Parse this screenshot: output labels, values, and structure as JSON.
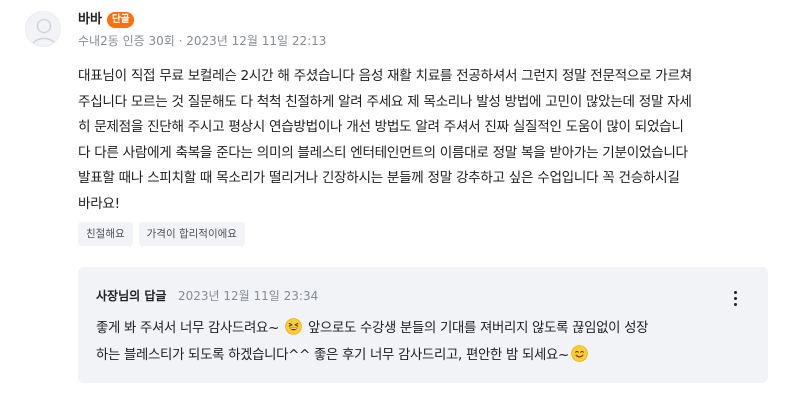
{
  "review": {
    "nickname": "바바",
    "badge": "단골",
    "meta": "수내2동 인증 30회 · 2023년 12월 11일 22:13",
    "body_lines": [
      "대표님이 직접 무료 보컬레슨 2시간 해 주셨습니다 음성 재활 치료를 전공하셔서 그런지 정말 전문적으로 가르쳐",
      "주십니다 모르는 것 질문해도 다 척척 친절하게 알려 주세요 제 목소리나 발성 방법에 고민이 많았는데 정말 자세",
      "히 문제점을 진단해 주시고 평상시 연습방법이나 개선 방법도 알려 주셔서 진짜 실질적인 도움이 많이 되었습니",
      "다 다른 사람에게 축복을 준다는 의미의 블레스티 엔터테인먼트의 이름대로 정말 복을 받아가는 기분이었습니다",
      "발표할 때나 스피치할 때 목소리가 떨리거나 긴장하시는 분들께 정말 강추하고 싶은 수업입니다 꼭 건승하시길",
      "바라요!"
    ],
    "tags": [
      "친절해요",
      "가격이 합리적이에요"
    ]
  },
  "reply": {
    "author": "사장님의 답글",
    "time": "2023년 12월 11일 23:34",
    "line1_before_emoji": "좋게 봐 주셔서 너무 감사드려요~",
    "line1_after_emoji": "앞으로도 수강생 분들의 기대를 져버리지 않도록 끊임없이 성장",
    "line2": "하는 블레스티가 되도록 하겠습니다^^ 좋은 후기 너무 감사드리고, 편안한 밤 되세요~",
    "emoji_1": "grinning-squint-face-icon",
    "emoji_2": "smiling-face-icon"
  },
  "colors": {
    "badge": "#ff6f0f",
    "meta_text": "#868b94",
    "tag_bg": "#f2f3f6",
    "reply_bg": "#f2f3f6"
  }
}
